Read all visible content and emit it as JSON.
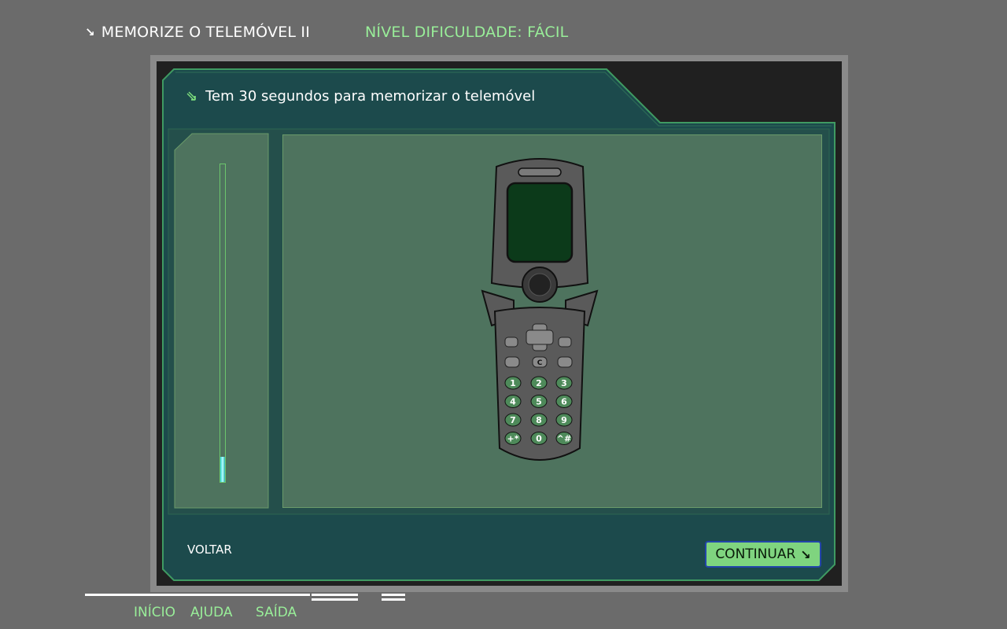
{
  "header": {
    "title": "MEMORIZE O TELEMÓVEL II",
    "title_icon": "arrow-down-right-icon",
    "level": "NÍVEL DIFICULDADE: FÁCIL"
  },
  "instruction": {
    "text": "Tem 30 segundos para memorizar o telemóvel",
    "icon": "double-arrow-down-right-icon"
  },
  "timer": {
    "remaining_fraction": 0.08
  },
  "phone": {
    "keys": [
      "1",
      "2",
      "3",
      "4",
      "5",
      "6",
      "7",
      "8",
      "9",
      "+*",
      "0",
      "^#"
    ],
    "soft_keys": [
      "menu-icon",
      "mail-icon"
    ],
    "call_keys": [
      "call-icon",
      "C",
      "end-call-icon"
    ]
  },
  "footer": {
    "back_label": "VOLTAR",
    "continue_label": "CONTINUAR"
  },
  "nav": {
    "inicio": "INÍCIO",
    "ajuda": "AJUDA",
    "saida": "SAÍDA"
  },
  "colors": {
    "background": "#6b6b6b",
    "panel": "#1c4a4c",
    "accent_green": "#99ee99",
    "panel_green": "#4e735e"
  }
}
